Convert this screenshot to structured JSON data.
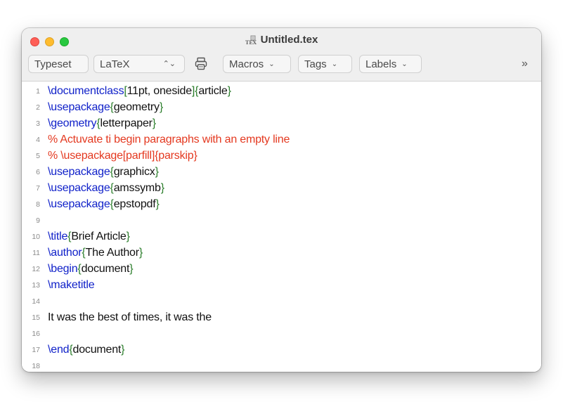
{
  "window": {
    "title": "Untitled.tex",
    "icon": "tex-file-icon",
    "traffic_colors": {
      "close": "#fe5f57",
      "minimize": "#febc2e",
      "zoom": "#28c840"
    }
  },
  "toolbar": {
    "typeset_label": "Typeset",
    "engine_value": "LaTeX",
    "macros_label": "Macros",
    "tags_label": "Tags",
    "labels_label": "Labels",
    "more_label": "»"
  },
  "colors": {
    "command": "#1021c9",
    "brace": "#2a7d2a",
    "comment": "#e4381f",
    "text": "#111111"
  },
  "editor": {
    "lines": [
      {
        "num": "1",
        "segments": [
          {
            "t": "\\documentclass",
            "c": "cmd"
          },
          {
            "t": "[",
            "c": "br"
          },
          {
            "t": "11pt, oneside",
            "c": "txt"
          },
          {
            "t": "]{",
            "c": "br"
          },
          {
            "t": "article",
            "c": "txt"
          },
          {
            "t": "}",
            "c": "br"
          }
        ]
      },
      {
        "num": "2",
        "segments": [
          {
            "t": "\\usepackage",
            "c": "cmd"
          },
          {
            "t": "{",
            "c": "br"
          },
          {
            "t": "geometry",
            "c": "txt"
          },
          {
            "t": "}",
            "c": "br"
          }
        ]
      },
      {
        "num": "3",
        "segments": [
          {
            "t": "\\geometry",
            "c": "cmd"
          },
          {
            "t": "{",
            "c": "br"
          },
          {
            "t": "letterpaper",
            "c": "txt"
          },
          {
            "t": "}",
            "c": "br"
          }
        ]
      },
      {
        "num": "4",
        "segments": [
          {
            "t": "% Actuvate ti begin paragraphs with an empty line",
            "c": "cmt"
          }
        ]
      },
      {
        "num": "5",
        "segments": [
          {
            "t": "% \\usepackage[parfill]{parskip}",
            "c": "cmt"
          }
        ]
      },
      {
        "num": "6",
        "segments": [
          {
            "t": "\\usepackage",
            "c": "cmd"
          },
          {
            "t": "{",
            "c": "br"
          },
          {
            "t": "graphicx",
            "c": "txt"
          },
          {
            "t": "}",
            "c": "br"
          }
        ]
      },
      {
        "num": "7",
        "segments": [
          {
            "t": "\\usepackage",
            "c": "cmd"
          },
          {
            "t": "{",
            "c": "br"
          },
          {
            "t": "amssymb",
            "c": "txt"
          },
          {
            "t": "}",
            "c": "br"
          }
        ]
      },
      {
        "num": "8",
        "segments": [
          {
            "t": "\\usepackage",
            "c": "cmd"
          },
          {
            "t": "{",
            "c": "br"
          },
          {
            "t": "epstopdf",
            "c": "txt"
          },
          {
            "t": "}",
            "c": "br"
          }
        ]
      },
      {
        "num": "9",
        "segments": []
      },
      {
        "num": "10",
        "segments": [
          {
            "t": "\\title",
            "c": "cmd"
          },
          {
            "t": "{",
            "c": "br"
          },
          {
            "t": "Brief Article",
            "c": "txt"
          },
          {
            "t": "}",
            "c": "br"
          }
        ]
      },
      {
        "num": "11",
        "segments": [
          {
            "t": "\\author",
            "c": "cmd"
          },
          {
            "t": "{",
            "c": "br"
          },
          {
            "t": "The Author",
            "c": "txt"
          },
          {
            "t": "}",
            "c": "br"
          }
        ]
      },
      {
        "num": "12",
        "segments": [
          {
            "t": "\\begin",
            "c": "cmd"
          },
          {
            "t": "{",
            "c": "br"
          },
          {
            "t": "document",
            "c": "txt"
          },
          {
            "t": "}",
            "c": "br"
          }
        ]
      },
      {
        "num": "13",
        "segments": [
          {
            "t": "\\maketitle",
            "c": "cmd"
          }
        ]
      },
      {
        "num": "14",
        "segments": []
      },
      {
        "num": "15",
        "segments": [
          {
            "t": "It was the best of times, it was the",
            "c": "txt"
          }
        ]
      },
      {
        "num": "16",
        "segments": []
      },
      {
        "num": "17",
        "segments": [
          {
            "t": "\\end",
            "c": "cmd"
          },
          {
            "t": "{",
            "c": "br"
          },
          {
            "t": "document",
            "c": "txt"
          },
          {
            "t": "}",
            "c": "br"
          }
        ]
      },
      {
        "num": "18",
        "segments": []
      }
    ]
  }
}
